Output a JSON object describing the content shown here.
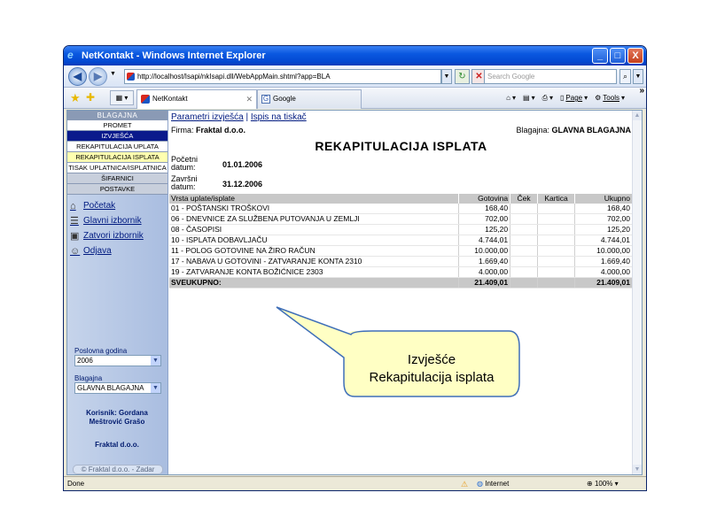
{
  "window": {
    "title": "NetKontakt - Windows Internet Explorer",
    "minimize_glyph": "_",
    "maximize_glyph": "□",
    "close_glyph": "X"
  },
  "addressbar": {
    "url": "http://localhost/Isapi/nkIsapi.dll/WebAppMain.shtml?app=BLA",
    "search_placeholder": "Search Google"
  },
  "tabs": [
    {
      "label": "NetKontakt",
      "active": true
    },
    {
      "label": "Google",
      "active": false
    }
  ],
  "command_bar": {
    "page_label": "Page",
    "tools_label": "Tools"
  },
  "sidebar": {
    "header": "BLAGAJNA",
    "items": [
      {
        "label": "PROMET",
        "state": "normal"
      },
      {
        "label": "IZVJEŠĆA",
        "state": "selected"
      },
      {
        "label": "REKAPITULACIJA UPLATA",
        "state": "normal"
      },
      {
        "label": "REKAPITULACIJA ISPLATA",
        "state": "yellow"
      },
      {
        "label": "TISAK UPLATNICA/ISPLATNICA",
        "state": "normal"
      },
      {
        "label": "ŠIFARNICI",
        "state": "gray"
      },
      {
        "label": "POSTAVKE",
        "state": "gray"
      }
    ],
    "links": [
      {
        "label": "Početak",
        "icon": "home-icon"
      },
      {
        "label": "Glavni izbornik",
        "icon": "menu-icon"
      },
      {
        "label": "Zatvori izbornik",
        "icon": "close-menu-icon"
      },
      {
        "label": "Odjava",
        "icon": "user-logout-icon"
      }
    ],
    "year_label": "Poslovna godina",
    "year_value": "2006",
    "cash_label": "Blagajna",
    "cash_value": "GLAVNA BLAGAJNA",
    "user_line1": "Korisnik: Gordana",
    "user_line2": "Meštrović Grašo",
    "company": "Fraktal d.o.o.",
    "copyright": "© Fraktal d.o.o. - Zadar"
  },
  "report": {
    "link_params": "Parametri izvješća",
    "separator": "|",
    "link_print": "Ispis na tiskač",
    "firma_label": "Firma:",
    "firma_value": "Fraktal d.o.o.",
    "blagajna_label": "Blagajna:",
    "blagajna_value": "GLAVNA BLAGAJNA",
    "title": "REKAPITULACIJA ISPLATA",
    "start_label": "Početni datum:",
    "start_value": "01.01.2006",
    "end_label": "Završni datum:",
    "end_value": "31.12.2006",
    "columns": [
      "Vrsta uplate/isplate",
      "Gotovina",
      "Ček",
      "Kartica",
      "Ukupno"
    ],
    "rows": [
      {
        "name": "01 - POŠTANSKI TROŠKOVI",
        "gotovina": "168,40",
        "cek": "",
        "kartica": "",
        "ukupno": "168,40"
      },
      {
        "name": "06 - DNEVNICE ZA SLUŽBENA PUTOVANJA U ZEMLJI",
        "gotovina": "702,00",
        "cek": "",
        "kartica": "",
        "ukupno": "702,00"
      },
      {
        "name": "08 - ČASOPISI",
        "gotovina": "125,20",
        "cek": "",
        "kartica": "",
        "ukupno": "125,20"
      },
      {
        "name": "10 - ISPLATA DOBAVLJAČU",
        "gotovina": "4.744,01",
        "cek": "",
        "kartica": "",
        "ukupno": "4.744,01"
      },
      {
        "name": "11 - POLOG GOTOVINE NA ŽIRO RAČUN",
        "gotovina": "10.000,00",
        "cek": "",
        "kartica": "",
        "ukupno": "10.000,00"
      },
      {
        "name": "17 - NABAVA U GOTOVINI - ZATVARANJE KONTA 2310",
        "gotovina": "1.669,40",
        "cek": "",
        "kartica": "",
        "ukupno": "1.669,40"
      },
      {
        "name": "19 - ZATVARANJE KONTA BOŽIĆNICE 2303",
        "gotovina": "4.000,00",
        "cek": "",
        "kartica": "",
        "ukupno": "4.000,00"
      }
    ],
    "total": {
      "name": "SVEUKUPNO:",
      "gotovina": "21.409,01",
      "cek": "",
      "kartica": "",
      "ukupno": "21.409,01"
    }
  },
  "statusbar": {
    "status": "Done",
    "zone": "Internet",
    "zoom": "100%"
  },
  "callout": {
    "line1": "Izvješće",
    "line2": "Rekapitulacija isplata",
    "fill": "#ffffc4",
    "stroke": "#3f6fb8"
  }
}
